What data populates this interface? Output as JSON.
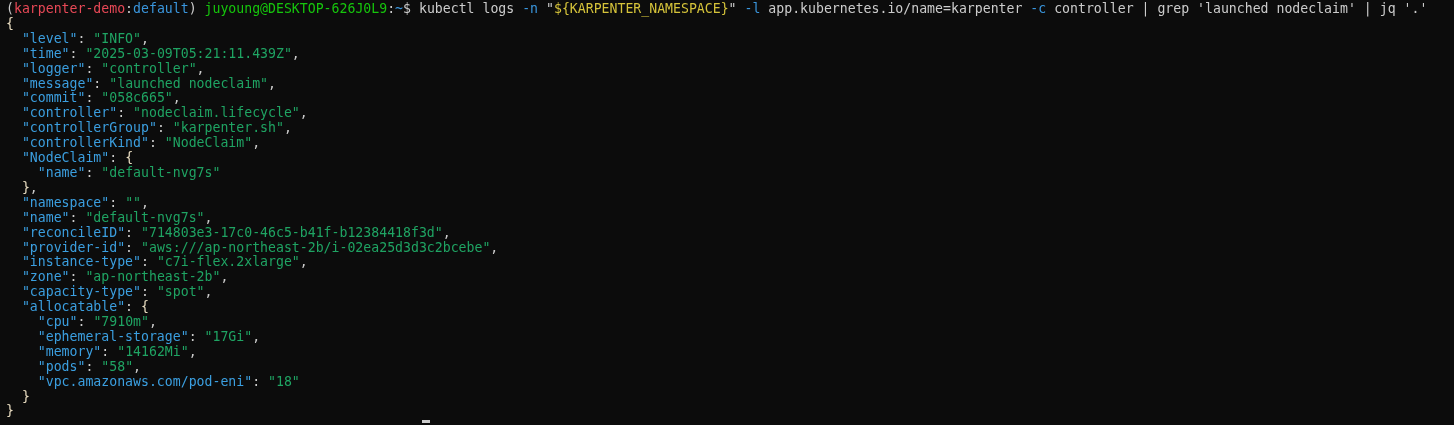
{
  "command_line": [
    {
      "text": "(",
      "kind": "plain"
    },
    {
      "text": "karpenter-demo",
      "kind": "red"
    },
    {
      "text": ":",
      "kind": "plain"
    },
    {
      "text": "default",
      "kind": "path"
    },
    {
      "text": ") ",
      "kind": "plain"
    },
    {
      "text": "juyoung@DESKTOP-626J0L9",
      "kind": "user"
    },
    {
      "text": ":",
      "kind": "plain"
    },
    {
      "text": "~",
      "kind": "path"
    },
    {
      "text": "$ kubectl logs ",
      "kind": "plain"
    },
    {
      "text": "-n",
      "kind": "flag"
    },
    {
      "text": " \"",
      "kind": "plain"
    },
    {
      "text": "${KARPENTER_NAMESPACE}",
      "kind": "var"
    },
    {
      "text": "\" ",
      "kind": "plain"
    },
    {
      "text": "-l",
      "kind": "flag"
    },
    {
      "text": " app.kubernetes.io/name=karpenter ",
      "kind": "plain"
    },
    {
      "text": "-c",
      "kind": "flag"
    },
    {
      "text": " controller | grep 'launched nodeclaim' | jq '.'",
      "kind": "plain"
    }
  ],
  "output": {
    "open": [
      {
        "text": "{",
        "kind": "brace"
      }
    ],
    "children": [
      {
        "tokens": [
          {
            "text": "\"level\"",
            "kind": "key"
          },
          {
            "text": ": ",
            "kind": "plain"
          },
          {
            "text": "\"INFO\"",
            "kind": "str"
          },
          {
            "text": ",",
            "kind": "plain"
          }
        ]
      },
      {
        "tokens": [
          {
            "text": "\"time\"",
            "kind": "key"
          },
          {
            "text": ": ",
            "kind": "plain"
          },
          {
            "text": "\"2025-03-09T05:21:11.439Z\"",
            "kind": "str"
          },
          {
            "text": ",",
            "kind": "plain"
          }
        ]
      },
      {
        "tokens": [
          {
            "text": "\"logger\"",
            "kind": "key"
          },
          {
            "text": ": ",
            "kind": "plain"
          },
          {
            "text": "\"controller\"",
            "kind": "str"
          },
          {
            "text": ",",
            "kind": "plain"
          }
        ]
      },
      {
        "tokens": [
          {
            "text": "\"message\"",
            "kind": "key"
          },
          {
            "text": ": ",
            "kind": "plain"
          },
          {
            "text": "\"launched nodeclaim\"",
            "kind": "str"
          },
          {
            "text": ",",
            "kind": "plain"
          }
        ]
      },
      {
        "tokens": [
          {
            "text": "\"commit\"",
            "kind": "key"
          },
          {
            "text": ": ",
            "kind": "plain"
          },
          {
            "text": "\"058c665\"",
            "kind": "str"
          },
          {
            "text": ",",
            "kind": "plain"
          }
        ]
      },
      {
        "tokens": [
          {
            "text": "\"controller\"",
            "kind": "key"
          },
          {
            "text": ": ",
            "kind": "plain"
          },
          {
            "text": "\"nodeclaim.lifecycle\"",
            "kind": "str"
          },
          {
            "text": ",",
            "kind": "plain"
          }
        ]
      },
      {
        "tokens": [
          {
            "text": "\"controllerGroup\"",
            "kind": "key"
          },
          {
            "text": ": ",
            "kind": "plain"
          },
          {
            "text": "\"karpenter.sh\"",
            "kind": "str"
          },
          {
            "text": ",",
            "kind": "plain"
          }
        ]
      },
      {
        "tokens": [
          {
            "text": "\"controllerKind\"",
            "kind": "key"
          },
          {
            "text": ": ",
            "kind": "plain"
          },
          {
            "text": "\"NodeClaim\"",
            "kind": "str"
          },
          {
            "text": ",",
            "kind": "plain"
          }
        ]
      },
      {
        "tokens": [
          {
            "text": "\"NodeClaim\"",
            "kind": "key"
          },
          {
            "text": ": ",
            "kind": "plain"
          },
          {
            "text": "{",
            "kind": "brace"
          }
        ],
        "children": [
          {
            "tokens": [
              {
                "text": "\"name\"",
                "kind": "key"
              },
              {
                "text": ": ",
                "kind": "plain"
              },
              {
                "text": "\"default-nvg7s\"",
                "kind": "str"
              }
            ]
          }
        ],
        "close": [
          {
            "text": "}",
            "kind": "brace"
          },
          {
            "text": ",",
            "kind": "plain"
          }
        ]
      },
      {
        "tokens": [
          {
            "text": "\"namespace\"",
            "kind": "key"
          },
          {
            "text": ": ",
            "kind": "plain"
          },
          {
            "text": "\"\"",
            "kind": "str"
          },
          {
            "text": ",",
            "kind": "plain"
          }
        ]
      },
      {
        "tokens": [
          {
            "text": "\"name\"",
            "kind": "key"
          },
          {
            "text": ": ",
            "kind": "plain"
          },
          {
            "text": "\"default-nvg7s\"",
            "kind": "str"
          },
          {
            "text": ",",
            "kind": "plain"
          }
        ]
      },
      {
        "tokens": [
          {
            "text": "\"reconcileID\"",
            "kind": "key"
          },
          {
            "text": ": ",
            "kind": "plain"
          },
          {
            "text": "\"714803e3-17c0-46c5-b41f-b12384418f3d\"",
            "kind": "str"
          },
          {
            "text": ",",
            "kind": "plain"
          }
        ]
      },
      {
        "tokens": [
          {
            "text": "\"provider-id\"",
            "kind": "key"
          },
          {
            "text": ": ",
            "kind": "plain"
          },
          {
            "text": "\"aws:///ap-northeast-2b/i-02ea25d3d3c2bcebe\"",
            "kind": "str"
          },
          {
            "text": ",",
            "kind": "plain"
          }
        ]
      },
      {
        "tokens": [
          {
            "text": "\"instance-type\"",
            "kind": "key"
          },
          {
            "text": ": ",
            "kind": "plain"
          },
          {
            "text": "\"c7i-flex.2xlarge\"",
            "kind": "str"
          },
          {
            "text": ",",
            "kind": "plain"
          }
        ]
      },
      {
        "tokens": [
          {
            "text": "\"zone\"",
            "kind": "key"
          },
          {
            "text": ": ",
            "kind": "plain"
          },
          {
            "text": "\"ap-northeast-2b\"",
            "kind": "str"
          },
          {
            "text": ",",
            "kind": "plain"
          }
        ]
      },
      {
        "tokens": [
          {
            "text": "\"capacity-type\"",
            "kind": "key"
          },
          {
            "text": ": ",
            "kind": "plain"
          },
          {
            "text": "\"spot\"",
            "kind": "str"
          },
          {
            "text": ",",
            "kind": "plain"
          }
        ]
      },
      {
        "tokens": [
          {
            "text": "\"allocatable\"",
            "kind": "key"
          },
          {
            "text": ": ",
            "kind": "plain"
          },
          {
            "text": "{",
            "kind": "brace"
          }
        ],
        "children": [
          {
            "tokens": [
              {
                "text": "\"cpu\"",
                "kind": "key"
              },
              {
                "text": ": ",
                "kind": "plain"
              },
              {
                "text": "\"7910m\"",
                "kind": "str"
              },
              {
                "text": ",",
                "kind": "plain"
              }
            ]
          },
          {
            "tokens": [
              {
                "text": "\"ephemeral-storage\"",
                "kind": "key"
              },
              {
                "text": ": ",
                "kind": "plain"
              },
              {
                "text": "\"17Gi\"",
                "kind": "str"
              },
              {
                "text": ",",
                "kind": "plain"
              }
            ]
          },
          {
            "tokens": [
              {
                "text": "\"memory\"",
                "kind": "key"
              },
              {
                "text": ": ",
                "kind": "plain"
              },
              {
                "text": "\"14162Mi\"",
                "kind": "str"
              },
              {
                "text": ",",
                "kind": "plain"
              }
            ]
          },
          {
            "tokens": [
              {
                "text": "\"pods\"",
                "kind": "key"
              },
              {
                "text": ": ",
                "kind": "plain"
              },
              {
                "text": "\"58\"",
                "kind": "str"
              },
              {
                "text": ",",
                "kind": "plain"
              }
            ]
          },
          {
            "tokens": [
              {
                "text": "\"vpc.amazonaws.com/pod-eni\"",
                "kind": "key"
              },
              {
                "text": ": ",
                "kind": "plain"
              },
              {
                "text": "\"18\"",
                "kind": "str"
              }
            ]
          }
        ],
        "close": [
          {
            "text": "}",
            "kind": "brace"
          }
        ]
      }
    ],
    "close": [
      {
        "text": "}",
        "kind": "brace"
      }
    ]
  }
}
